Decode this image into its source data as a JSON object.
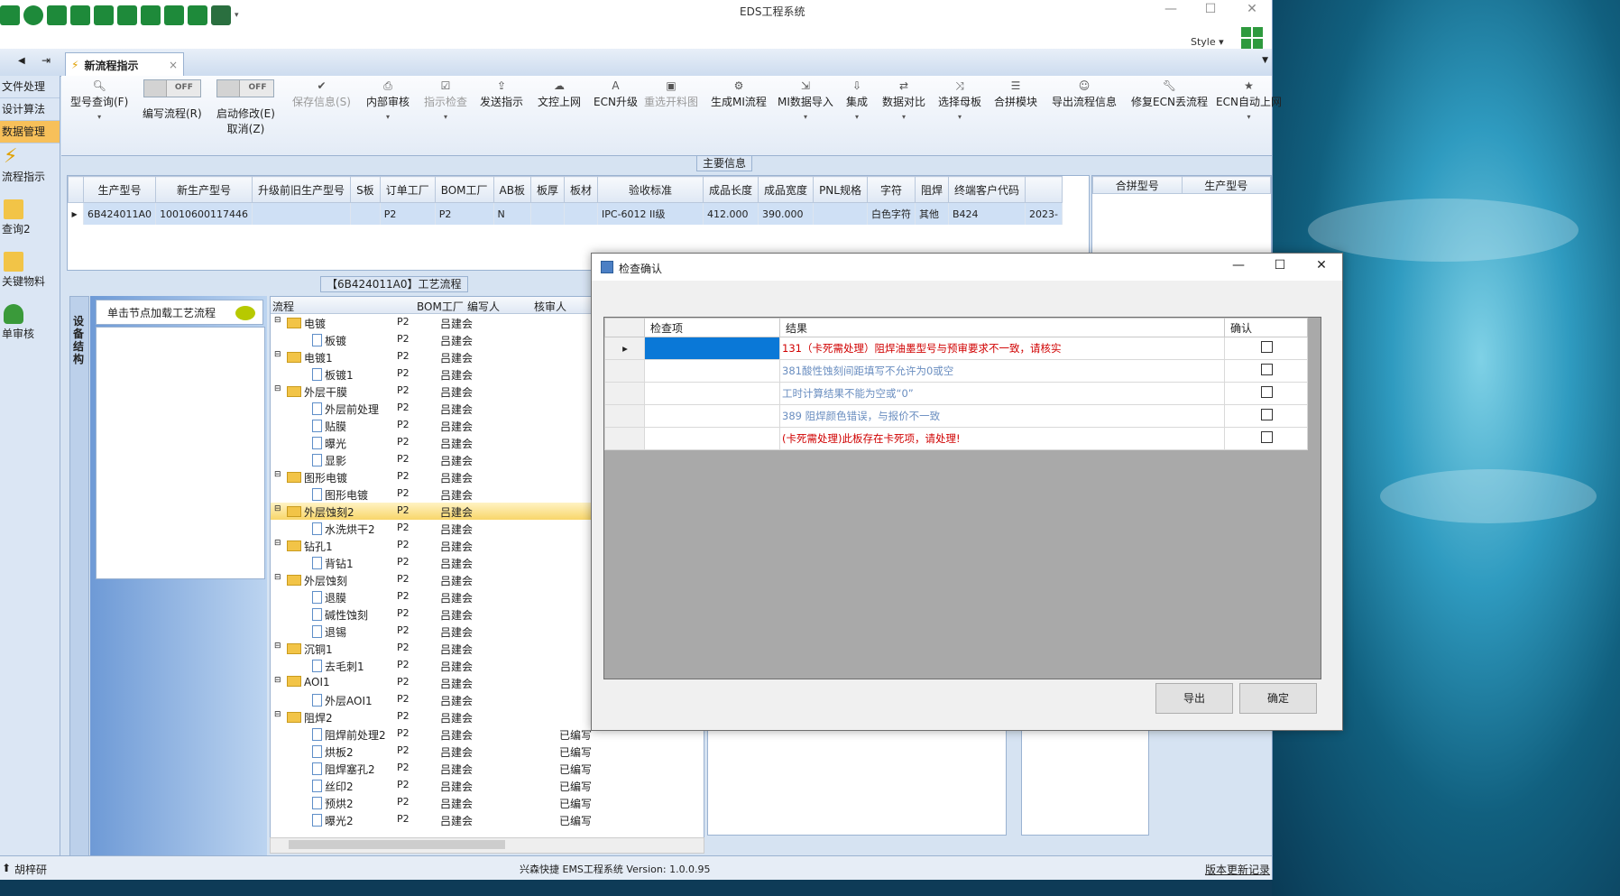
{
  "window": {
    "title": "EDS工程系统",
    "style_label": "Style"
  },
  "tab": {
    "label": "新流程指示",
    "close": "×"
  },
  "nav": {
    "items": [
      "文件处理",
      "设计算法",
      "数据管理"
    ],
    "big_items": [
      "流程指示",
      "查询2",
      "关键物料",
      "单审核"
    ]
  },
  "toolbar": {
    "buttons": [
      {
        "label": "型号查询(F)",
        "icon": "search-icon"
      },
      {
        "label": "编写流程(R)",
        "toggle": "OFF"
      },
      {
        "label": "启动修改(E)",
        "sub": "取消(Z)",
        "toggle": "OFF"
      },
      {
        "label": "保存信息(S)",
        "disabled": true
      },
      {
        "label": "内部审核"
      },
      {
        "label": "指示检查",
        "disabled": true
      },
      {
        "label": "发送指示"
      },
      {
        "label": "文控上网"
      },
      {
        "label": "ECN升级"
      },
      {
        "label": "重选开料图",
        "disabled": true
      },
      {
        "label": "生成MI流程"
      },
      {
        "label": "MI数据导入"
      },
      {
        "label": "集成"
      },
      {
        "label": "数据对比"
      },
      {
        "label": "选择母板"
      },
      {
        "label": "合拼模块"
      },
      {
        "label": "导出流程信息"
      },
      {
        "label": "修复ECN丢流程"
      },
      {
        "label": "ECN自动上网"
      }
    ]
  },
  "main_info": {
    "title": "主要信息",
    "columns": [
      "生产型号",
      "新生产型号",
      "升级前旧生产型号",
      "S板",
      "订单工厂",
      "BOM工厂",
      "AB板",
      "板厚",
      "板材",
      "验收标准",
      "成品长度",
      "成品宽度",
      "PNL规格",
      "字符",
      "阻焊",
      "终端客户代码"
    ],
    "row": [
      "6B424011A0",
      "10010600117446",
      "",
      "",
      "P2",
      "P2",
      "N",
      "",
      "",
      "IPC-6012 II级",
      "412.000",
      "390.000",
      "",
      "白色字符",
      "其他",
      "B424",
      "2023-"
    ],
    "right_columns": [
      "合拼型号",
      "生产型号"
    ]
  },
  "flow": {
    "title": "【6B424011A0】工艺流程",
    "side_tab": "设备结构",
    "click_hint": "单击节点加载工艺流程",
    "headers": [
      "流程",
      "BOM工厂",
      "编写人",
      "核审人"
    ],
    "rows": [
      {
        "name": "电镀",
        "level": 0,
        "factory": "P2",
        "writer": "吕建会"
      },
      {
        "name": "板镀",
        "level": 1,
        "factory": "P2",
        "writer": "吕建会"
      },
      {
        "name": "电镀1",
        "level": 0,
        "factory": "P2",
        "writer": "吕建会"
      },
      {
        "name": "板镀1",
        "level": 1,
        "factory": "P2",
        "writer": "吕建会"
      },
      {
        "name": "外层干膜",
        "level": 0,
        "factory": "P2",
        "writer": "吕建会"
      },
      {
        "name": "外层前处理",
        "level": 1,
        "factory": "P2",
        "writer": "吕建会"
      },
      {
        "name": "贴膜",
        "level": 1,
        "factory": "P2",
        "writer": "吕建会"
      },
      {
        "name": "曝光",
        "level": 1,
        "factory": "P2",
        "writer": "吕建会"
      },
      {
        "name": "显影",
        "level": 1,
        "factory": "P2",
        "writer": "吕建会"
      },
      {
        "name": "图形电镀",
        "level": 0,
        "factory": "P2",
        "writer": "吕建会"
      },
      {
        "name": "图形电镀",
        "level": 1,
        "factory": "P2",
        "writer": "吕建会"
      },
      {
        "name": "外层蚀刻2",
        "level": 0,
        "factory": "P2",
        "writer": "吕建会",
        "highlight": true
      },
      {
        "name": "水洗烘干2",
        "level": 1,
        "factory": "P2",
        "writer": "吕建会"
      },
      {
        "name": "钻孔1",
        "level": 0,
        "factory": "P2",
        "writer": "吕建会"
      },
      {
        "name": "背钻1",
        "level": 1,
        "factory": "P2",
        "writer": "吕建会"
      },
      {
        "name": "外层蚀刻",
        "level": 0,
        "factory": "P2",
        "writer": "吕建会"
      },
      {
        "name": "退膜",
        "level": 1,
        "factory": "P2",
        "writer": "吕建会"
      },
      {
        "name": "碱性蚀刻",
        "level": 1,
        "factory": "P2",
        "writer": "吕建会"
      },
      {
        "name": "退锡",
        "level": 1,
        "factory": "P2",
        "writer": "吕建会"
      },
      {
        "name": "沉铜1",
        "level": 0,
        "factory": "P2",
        "writer": "吕建会"
      },
      {
        "name": "去毛刺1",
        "level": 1,
        "factory": "P2",
        "writer": "吕建会"
      },
      {
        "name": "AOI1",
        "level": 0,
        "factory": "P2",
        "writer": "吕建会"
      },
      {
        "name": "外层AOI1",
        "level": 1,
        "factory": "P2",
        "writer": "吕建会"
      },
      {
        "name": "阻焊2",
        "level": 0,
        "factory": "P2",
        "writer": "吕建会"
      },
      {
        "name": "阻焊前处理2",
        "level": 1,
        "factory": "P2",
        "writer": "吕建会",
        "status": "已编写"
      },
      {
        "name": "烘板2",
        "level": 1,
        "factory": "P2",
        "writer": "吕建会",
        "status": "已编写"
      },
      {
        "name": "阻焊塞孔2",
        "level": 1,
        "factory": "P2",
        "writer": "吕建会",
        "status": "已编写"
      },
      {
        "name": "丝印2",
        "level": 1,
        "factory": "P2",
        "writer": "吕建会",
        "status": "已编写"
      },
      {
        "name": "预烘2",
        "level": 1,
        "factory": "P2",
        "writer": "吕建会",
        "status": "已编写"
      },
      {
        "name": "曝光2",
        "level": 1,
        "factory": "P2",
        "writer": "吕建会",
        "status": "已编写"
      }
    ]
  },
  "status": {
    "user": "胡梓研",
    "version": "兴森快捷 EMS工程系统 Version: 1.0.0.95",
    "update_link": "版本更新记录"
  },
  "dialog": {
    "title": "检查确认",
    "columns": [
      "检查项",
      "结果",
      "确认"
    ],
    "rows": [
      {
        "result": "131（卡死需处理）阻焊油墨型号与预审要求不一致，请核实",
        "color": "#d00000"
      },
      {
        "result": "381酸性蚀刻间距填写不允许为0或空",
        "color": "#6a8ec0"
      },
      {
        "result": "工时计算结果不能为空或“0”",
        "color": "#6a8ec0"
      },
      {
        "result": "389 阻焊颜色错误，与报价不一致",
        "color": "#6a8ec0"
      },
      {
        "result": "(卡死需处理)此板存在卡死项，请处理!",
        "color": "#d00000"
      }
    ],
    "export_label": "导出",
    "ok_label": "确定"
  }
}
